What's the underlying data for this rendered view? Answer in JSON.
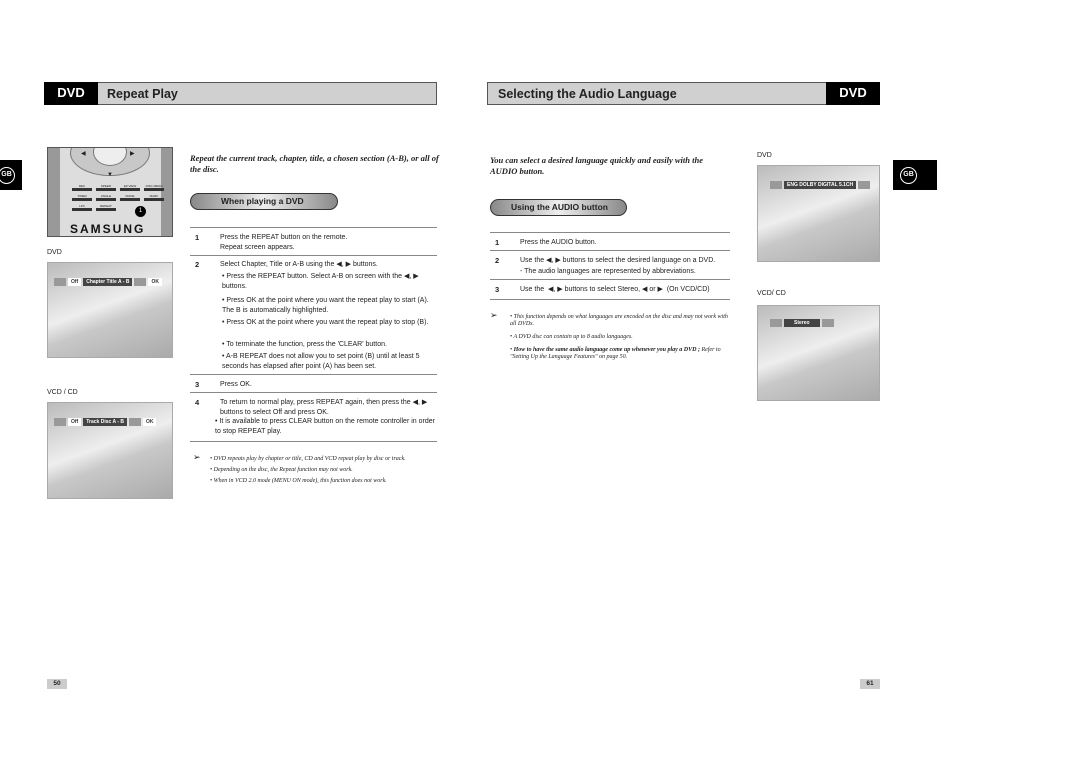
{
  "left_page": {
    "badge": "DVD",
    "title": "Repeat Play",
    "lang_tab": "GB",
    "intro": "Repeat the current track, chapter, title, a chosen section (A-B), or all of the disc.",
    "section_pill": "When playing a DVD",
    "remote": {
      "buttons": [
        "REC",
        "SPEED",
        "EZ VIEW",
        "DISC MENU",
        "TIMER",
        "ANGLE",
        "MODE",
        "MARK",
        "LPC",
        "REPEAT"
      ],
      "callout": "1",
      "brand": "SAMSUNG"
    },
    "screen_dvd": {
      "label": "DVD",
      "osd": [
        "Off",
        "Chapter",
        "Title",
        "A - B",
        "OK"
      ]
    },
    "screen_vcd": {
      "label": "VCD / CD",
      "osd": [
        "Off",
        "Track",
        "Disc",
        "A - B",
        "OK"
      ]
    },
    "steps": [
      {
        "num": "1",
        "lines": [
          "Press the REPEAT button on the remote.",
          "Repeat screen appears."
        ]
      },
      {
        "num": "2",
        "text": "Select Chapter, Title or A-B using the ◀, ▶ buttons.",
        "bullets": [
          "Press the REPEAT button. Select A-B on screen with the ◀, ▶ buttons.",
          "Press OK at the point where you want the repeat play to start (A). The B is automatically highlighted.",
          "Press OK at the point where you want the repeat play to stop (B).",
          "To terminate the function, press the 'CLEAR' button.",
          "A-B REPEAT does not allow you to set point (B) until at least 5 seconds has elapsed after point (A) has been set."
        ]
      },
      {
        "num": "3",
        "text": "Press OK."
      },
      {
        "num": "4",
        "text": "To return to normal play, press REPEAT again, then press the ◀, ▶ buttons to select Off and press OK.",
        "bullets": [
          "It is available to press CLEAR button on the remote controller in order to stop REPEAT play."
        ]
      }
    ],
    "notes": [
      "DVD repeats play by chapter or title, CD and VCD repeat play by disc or track.",
      "Depending on the disc, the Repeat function may not work.",
      "When in VCD 2.0 mode (MENU ON mode), this function does not work."
    ],
    "page_number": "50"
  },
  "right_page": {
    "badge": "DVD",
    "title": "Selecting the Audio Language",
    "lang_tab": "GB",
    "intro": "You can select a desired language quickly and easily with the AUDIO button.",
    "section_pill": "Using the AUDIO button",
    "steps": [
      {
        "num": "1",
        "text": "Press the AUDIO button."
      },
      {
        "num": "2",
        "text": "Use the ◀, ▶ buttons to select the desired language on a DVD.",
        "sub": "- The audio languages are represented by abbreviations."
      },
      {
        "num": "3",
        "text": "Use the  ◀, ▶ buttons to select Stereo, ◀ or ▶  (On VCD/CD)"
      }
    ],
    "notes": [
      "This function depends on what languages are encoded on the disc and may not work with all DVDs.",
      "A DVD disc can contain up to 8 audio languages."
    ],
    "note_bold": "How to have the same audio language come up whenever you play a DVD ;",
    "note_tail": "Refer to \"Setting Up the Language Features\" on page 50.",
    "screen_dvd": {
      "label": "DVD",
      "osd": "ENG  DOLBY DIGITAL  5.1CH"
    },
    "screen_vcd": {
      "label": "VCD/ CD",
      "osd": "Stereo"
    },
    "page_number": "61"
  },
  "note_icon": "arrow-right-icon"
}
